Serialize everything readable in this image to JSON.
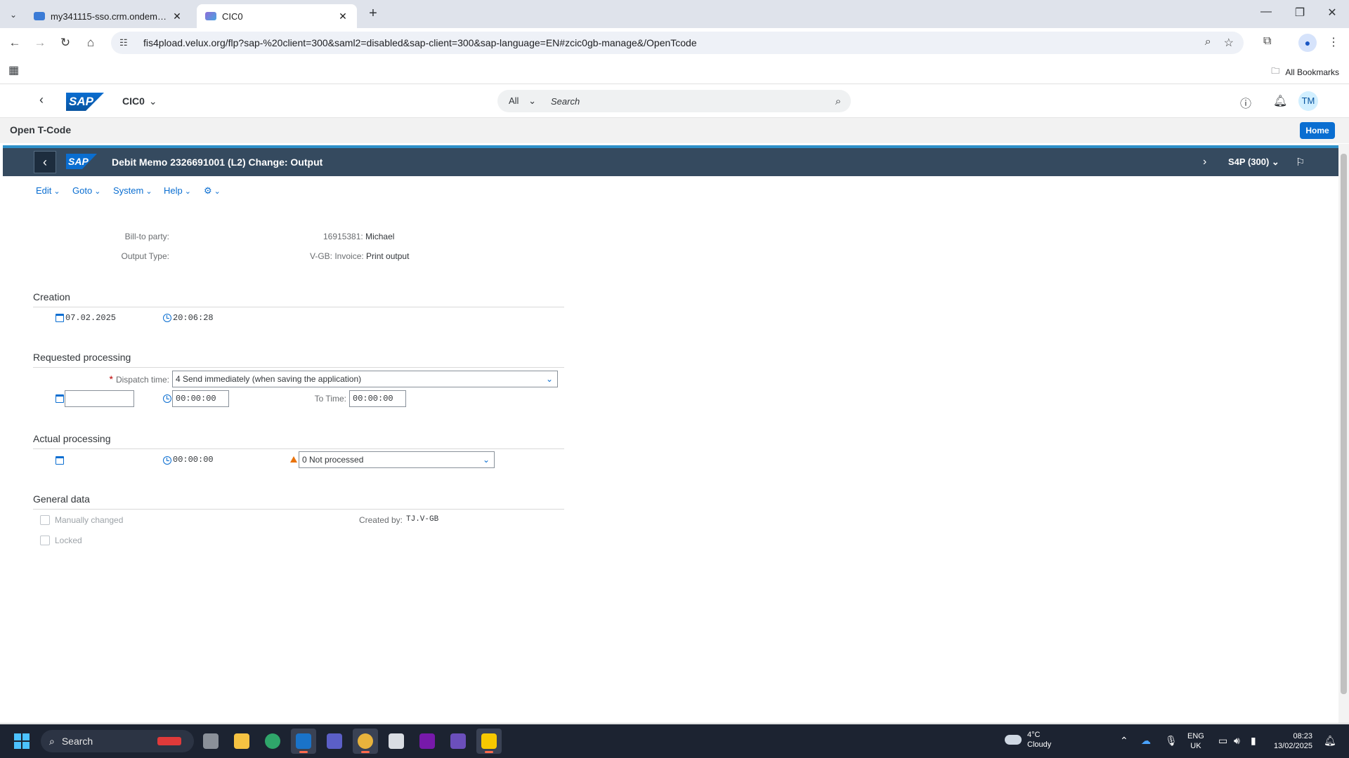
{
  "browser": {
    "tabs": [
      {
        "title": "my341115-sso.crm.ondemand.com"
      },
      {
        "title": "CIC0"
      }
    ],
    "url": "fis4pload.velux.org/flp?sap-%20client=300&saml2=disabled&sap-client=300&sap-language=EN#zcic0gb-manage&/OpenTcode",
    "bookmarks_label": "All Bookmarks"
  },
  "shell": {
    "logo": "SAP",
    "app_title": "CIC0",
    "search_scope": "All",
    "search_placeholder": "Search",
    "avatar": "TM"
  },
  "subheader": {
    "title": "Open T-Code",
    "home_label": "Home"
  },
  "titlebar": {
    "logo": "SAP",
    "title": "Debit Memo 2326691001 (L2) Change: Output",
    "system": "S4P (300)"
  },
  "menu": {
    "edit": "Edit",
    "goto": "Goto",
    "system": "System",
    "help": "Help"
  },
  "header": {
    "bill_to_label": "Bill-to party:",
    "bill_to_number": "16915381:",
    "bill_to_name": "Michael",
    "output_type_label": "Output Type:",
    "output_type_code": "V-GB: Invoice:",
    "output_type_desc": "Print output"
  },
  "creation": {
    "title": "Creation",
    "date": "07.02.2025",
    "time": "20:06:28"
  },
  "requested": {
    "title": "Requested processing",
    "dispatch_label": "Dispatch time:",
    "dispatch_value": "4 Send immediately (when saving the application)",
    "date_value": "",
    "time_value": "00:00:00",
    "to_time_label": "To Time:",
    "to_time_value": "00:00:00"
  },
  "actual": {
    "title": "Actual processing",
    "time": "00:00:00",
    "status_value": "0 Not processed"
  },
  "general": {
    "title": "General data",
    "manually_changed": "Manually changed",
    "locked": "Locked",
    "created_by_label": "Created by:",
    "created_by_value": "TJ.V-GB"
  },
  "taskbar": {
    "search_placeholder": "Search",
    "weather_temp": "4°C",
    "weather_desc": "Cloudy",
    "lang_1": "ENG",
    "lang_2": "UK",
    "time": "08:23",
    "date": "13/02/2025"
  }
}
